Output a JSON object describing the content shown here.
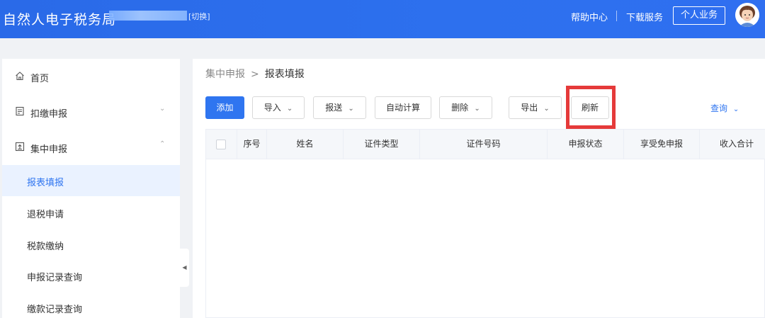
{
  "header": {
    "app_title": "自然人电子税务局",
    "switch_label": "[切换]",
    "help_center": "帮助中心",
    "download_service": "下载服务",
    "personal_business": "个人业务"
  },
  "colors": {
    "brand_blue": "#2f75f0",
    "highlight_red": "#e53a3a",
    "active_bg": "#eaf2ff"
  },
  "sidebar": {
    "items": [
      {
        "label": "首页",
        "icon": "home-icon"
      },
      {
        "label": "扣缴申报",
        "icon": "file-icon",
        "expanded": false
      },
      {
        "label": "集中申报",
        "icon": "upload-icon",
        "expanded": true
      }
    ],
    "sub_items": [
      {
        "label": "报表填报",
        "active": true
      },
      {
        "label": "退税申请"
      },
      {
        "label": "税款缴纳"
      },
      {
        "label": "申报记录查询"
      },
      {
        "label": "缴款记录查询"
      }
    ]
  },
  "breadcrumb": {
    "parent": "集中申报",
    "separator": ">",
    "current": "报表填报"
  },
  "toolbar": {
    "add": "添加",
    "import": "导入",
    "send": "报送",
    "auto_calc": "自动计算",
    "delete": "删除",
    "export": "导出",
    "refresh": "刷新",
    "query": "查询"
  },
  "table": {
    "columns": [
      "序号",
      "姓名",
      "证件类型",
      "证件号码",
      "申报状态",
      "享受免申报",
      "收入合计"
    ],
    "rows": []
  }
}
